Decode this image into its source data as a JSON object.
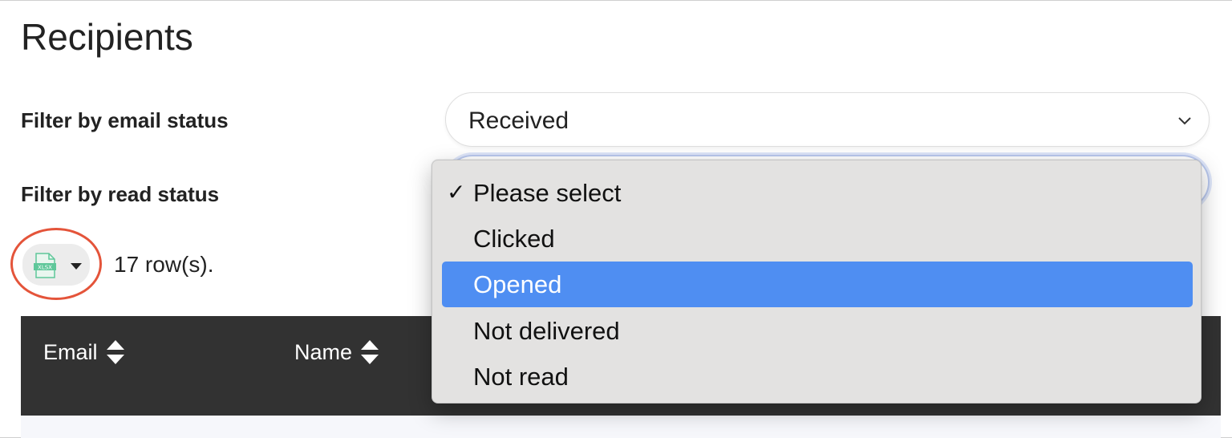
{
  "page": {
    "title": "Recipients"
  },
  "filters": {
    "email_status": {
      "label": "Filter by email status",
      "selected": "Received"
    },
    "read_status": {
      "label": "Filter by read status",
      "options": [
        {
          "label": "Please select",
          "checked": true,
          "highlighted": false
        },
        {
          "label": "Clicked",
          "checked": false,
          "highlighted": false
        },
        {
          "label": "Opened",
          "checked": false,
          "highlighted": true
        },
        {
          "label": "Not delivered",
          "checked": false,
          "highlighted": false
        },
        {
          "label": "Not read",
          "checked": false,
          "highlighted": false
        }
      ],
      "check_mark": "✓"
    }
  },
  "export": {
    "icon": "xlsx-file-icon",
    "icon_text": "XLSX",
    "annotation_color": "#e4543a"
  },
  "results": {
    "row_count": "17 row(s)."
  },
  "table": {
    "columns": [
      "Email",
      "Name"
    ],
    "header_color": "#323232"
  },
  "colors": {
    "highlight": "#4f8ef2",
    "dropdown_bg": "#e3e2e1"
  }
}
